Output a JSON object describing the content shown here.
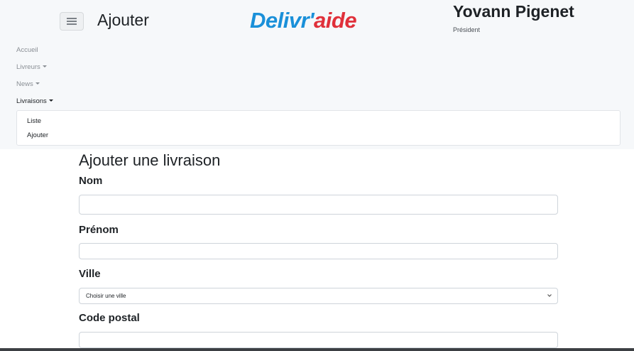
{
  "header": {
    "title": "Ajouter",
    "brand_part1": "Delivr'",
    "brand_part2": "aide",
    "brand_colors": [
      "#1a90d9",
      "#e0303a"
    ],
    "user_name": "Yovann Pigenet",
    "user_role": "Président"
  },
  "nav": {
    "items": [
      {
        "label": "Accueil"
      },
      {
        "label": "Livreurs"
      },
      {
        "label": "News"
      },
      {
        "label": "Livraisons"
      }
    ],
    "dropdown": [
      "Liste",
      "Ajouter"
    ]
  },
  "form": {
    "title": "Ajouter une livraison",
    "nom_label": "Nom",
    "nom_value": "",
    "prenom_label": "Prénom",
    "prenom_value": "",
    "ville_label": "Ville",
    "ville_selected": "Choisir une ville",
    "code_postal_label": "Code postal",
    "code_postal_value": ""
  },
  "icons": [
    "hamburger-menu-icon",
    "caret-down-icon",
    "chevron-down-icon"
  ]
}
